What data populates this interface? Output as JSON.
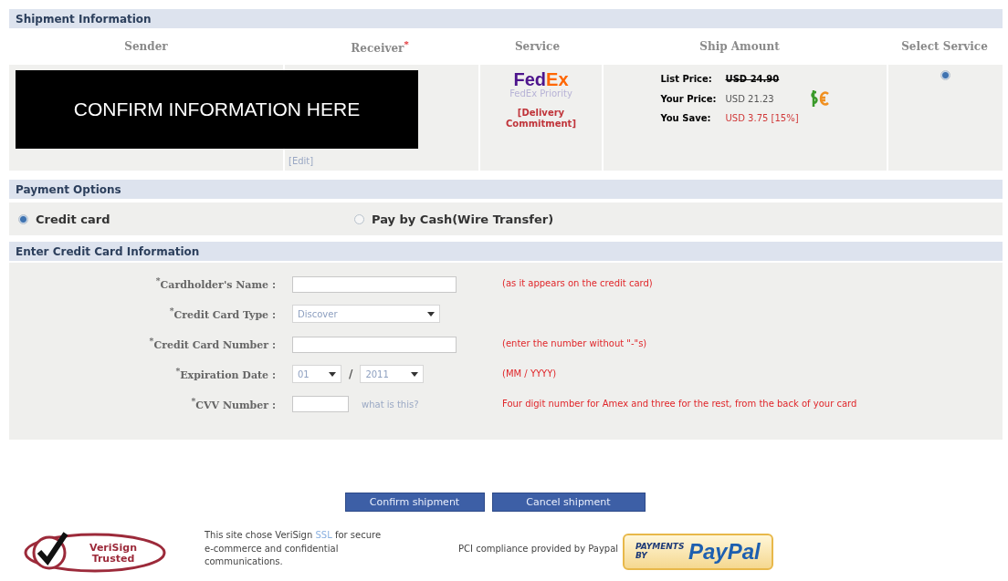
{
  "shipment": {
    "title": "Shipment Information",
    "columns": [
      "Sender",
      "Receiver$^{*}$",
      "Service",
      "Ship Amount",
      "Select Service"
    ],
    "receiver_edit": "[Edit]",
    "service": {
      "logo_a": "Fed",
      "logo_b": "Ex",
      "name": "FedEx Priority",
      "commitment": "[Delivery Commitment]"
    },
    "amount": {
      "list_label": "List Price:",
      "list_value": "USD 24.90",
      "your_label": "Your Price:",
      "your_value": "USD 21.23",
      "save_label": "You Save:",
      "save_value": "USD 3.75 [15%]"
    },
    "select_selected": true,
    "overlay": "CONFIRM INFORMATION HERE"
  },
  "payment": {
    "title": "Payment Options",
    "options": [
      {
        "label": "Credit card",
        "selected": true
      },
      {
        "label": "Pay by Cash(Wire Transfer)",
        "selected": false
      }
    ]
  },
  "card": {
    "title": "Enter Credit Card Information",
    "rows": [
      {
        "kind": "text",
        "label": "$^{*}$Cardholder's Name :",
        "hint": "(as it appears on the credit card)"
      },
      {
        "kind": "select",
        "label": "$^{*}$Credit Card Type :",
        "value": "Discover"
      },
      {
        "kind": "text",
        "label": "$^{*}$Credit Card Number :",
        "hint": "(enter the number without \"-\"s)"
      },
      {
        "kind": "date",
        "label": "$^{*}$Expiration Date :",
        "month": "01",
        "separator": "/",
        "year": "2011",
        "hint": "(MM / YYYY)"
      },
      {
        "kind": "cvv",
        "label": "$^{*}$CVV Number :",
        "link": "what is this?",
        "hint": "Four digit number for Amex and three for the rest, from the back of your card"
      }
    ]
  },
  "buttons": [
    "Confirm shipment",
    "Cancel shipment"
  ],
  "footer": {
    "verisign": {
      "line1": "VeriSign",
      "line2": "Trusted"
    },
    "ssl_text_before": "This site chose VeriSign ",
    "ssl_link": "SSL",
    "ssl_text_after": " for secure e-commerce and confidential communications.",
    "pci": "PCI compliance provided by Paypal",
    "paypal_a": "PAYMENTS BY",
    "paypal_b": "PayPal"
  }
}
